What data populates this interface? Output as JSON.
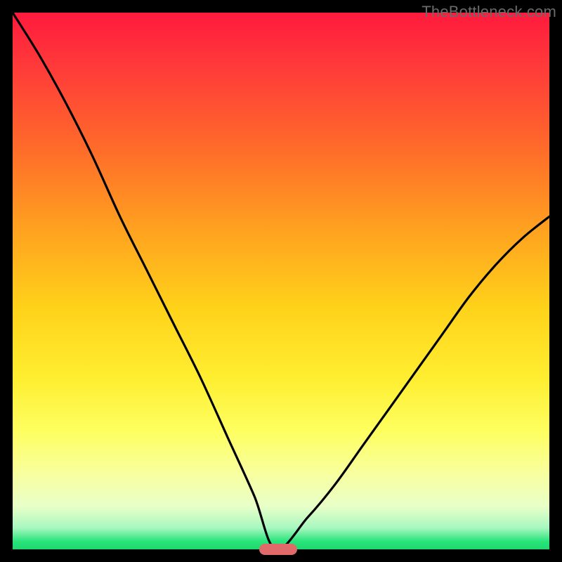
{
  "watermark": "TheBottleneck.com",
  "colors": {
    "frame": "#000000",
    "gradient_top": "#ff1a3d",
    "gradient_bottom": "#1fd86f",
    "curve": "#000000",
    "marker": "#e06a6a",
    "watermark": "#6b6b6b"
  },
  "chart_data": {
    "type": "line",
    "title": "",
    "xlabel": "",
    "ylabel": "",
    "xlim": [
      0,
      100
    ],
    "ylim": [
      0,
      100
    ],
    "grid": false,
    "legend": false,
    "description": "Single V-shaped bottleneck curve on a vertical red-to-green gradient. The curve represents bottleneck percentage vs. a component performance axis; minimum (best match) near x≈49 where bottleneck≈0. Values estimated from pixel positions.",
    "series": [
      {
        "name": "bottleneck",
        "x": [
          0,
          5,
          10,
          15,
          20,
          25,
          30,
          35,
          40,
          45,
          49,
          55,
          60,
          65,
          70,
          75,
          80,
          85,
          90,
          95,
          100
        ],
        "values": [
          100,
          92,
          83,
          73,
          62,
          52,
          42,
          32,
          21,
          10,
          0,
          6,
          12,
          19,
          26,
          33,
          40,
          47,
          53,
          58,
          62
        ]
      }
    ],
    "marker": {
      "x_start": 46,
      "x_end": 53,
      "y": 0
    }
  }
}
